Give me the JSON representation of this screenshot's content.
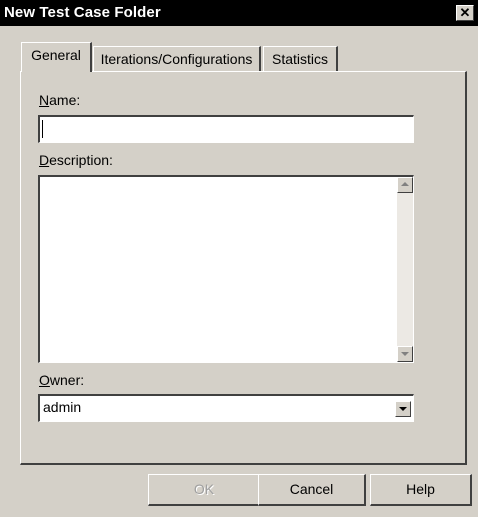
{
  "window": {
    "title": "New Test Case Folder",
    "close_glyph": "✕"
  },
  "tabs": [
    {
      "label": "General",
      "active": true
    },
    {
      "label": "Iterations/Configurations",
      "active": false
    },
    {
      "label": "Statistics",
      "active": false
    }
  ],
  "form": {
    "name_label_accel": "N",
    "name_label_rest": "ame:",
    "name_value": "",
    "description_label_accel": "D",
    "description_label_rest": "escription:",
    "description_value": "",
    "owner_label_accel": "O",
    "owner_label_rest": "wner:",
    "owner_value": "admin"
  },
  "buttons": {
    "ok": "OK",
    "cancel": "Cancel",
    "help": "Help"
  },
  "icons": {
    "close": "close-icon",
    "scroll_up": "scroll-up-arrow-icon",
    "scroll_down": "scroll-down-arrow-icon",
    "dropdown": "chevron-down-icon"
  },
  "colors": {
    "face": "#d4d0c8",
    "titlebar": "#000000"
  }
}
